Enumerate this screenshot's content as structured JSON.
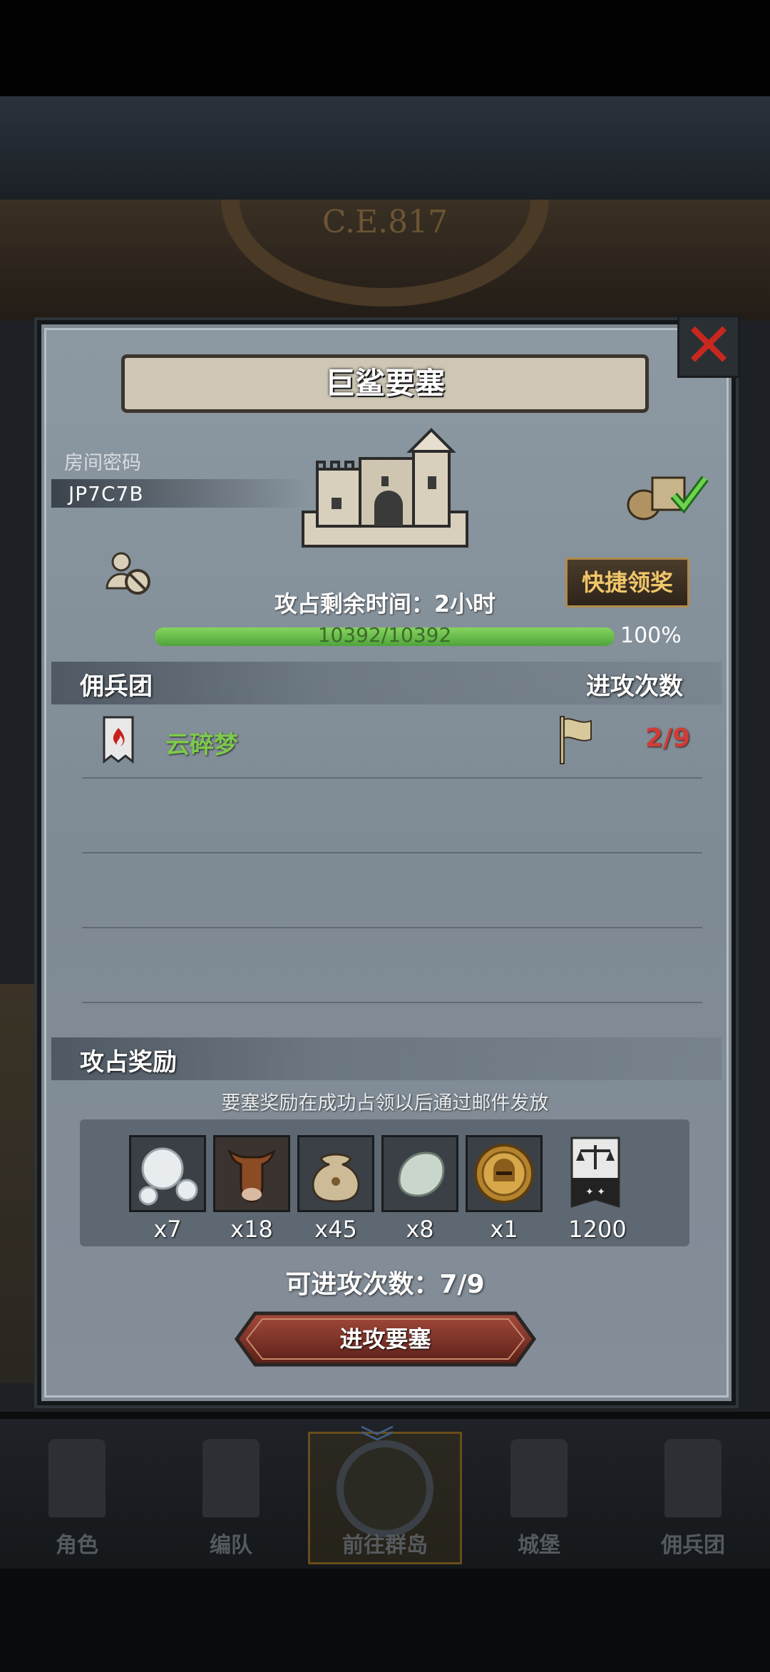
{
  "background": {
    "clock_text": "C.E.817"
  },
  "dialog": {
    "title": "巨鲨要塞",
    "room_password_label": "房间密码",
    "room_password_value": "JP7C7B",
    "quick_claim_label": "快捷领奖",
    "time_remaining": "攻占剩余时间：2小时",
    "hp_text": "10392/10392",
    "hp_percent_label": "100%",
    "hp_fraction": 1.0,
    "columns": {
      "mercenary": "佣兵团",
      "attack_count": "进攻次数"
    },
    "rows": [
      {
        "guild": "云碎梦",
        "attacks": "2/9"
      }
    ],
    "reward_heading": "攻占奖励",
    "reward_note": "要塞奖励在成功占领以后通过邮件发放",
    "rewards": [
      {
        "icon": "pearls-icon",
        "qty": "x7"
      },
      {
        "icon": "cow-icon",
        "qty": "x18"
      },
      {
        "icon": "money-bag-icon",
        "qty": "x45"
      },
      {
        "icon": "stone-icon",
        "qty": "x8"
      },
      {
        "icon": "gold-helmet-coin-icon",
        "qty": "x1"
      },
      {
        "icon": "scales-banner-icon",
        "qty": "1200"
      }
    ],
    "attempts_left": "可进攻次数：7/9",
    "attack_button": "进攻要塞"
  },
  "nav": {
    "items": [
      {
        "label": "角色"
      },
      {
        "label": "编队"
      },
      {
        "label": "前往群岛"
      },
      {
        "label": "城堡"
      },
      {
        "label": "佣兵团"
      }
    ]
  },
  "colors": {
    "guild_name": "#7dc94e",
    "attack_count": "#cf3d36",
    "close_red": "#c6281e",
    "claim_gold": "#f0c66a"
  }
}
